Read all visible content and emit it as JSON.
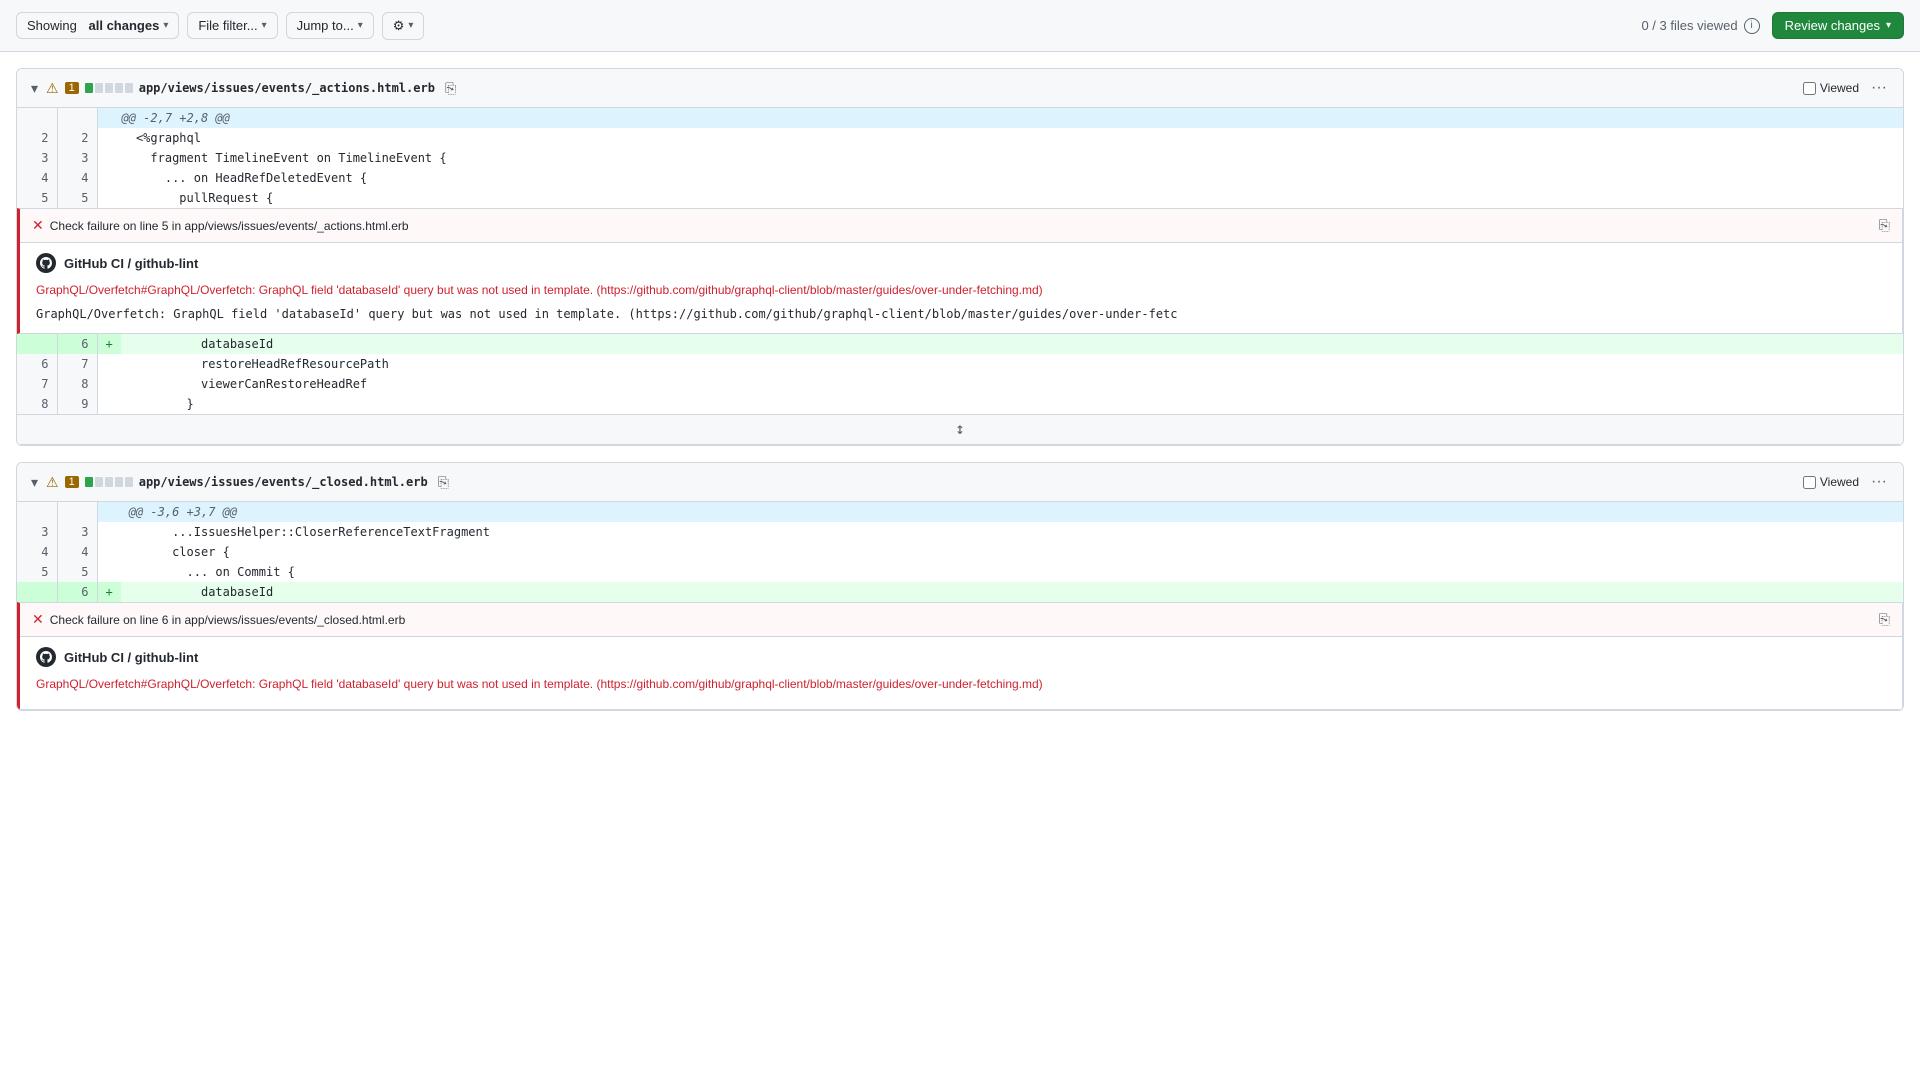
{
  "toolbar": {
    "showing_label": "Showing",
    "all_changes_label": "all changes",
    "file_filter_label": "File filter...",
    "jump_to_label": "Jump to...",
    "settings_label": "⚙",
    "files_viewed_label": "0 / 3 files viewed",
    "review_changes_label": "Review changes"
  },
  "file1": {
    "path": "app/views/issues/events/_actions.html.erb",
    "count": "1",
    "viewed_label": "Viewed",
    "hunk_header": "@@ -2,7 +2,8 @@",
    "check_failure_text": "Check failure on line 5 in app/views/issues/events/_actions.html.erb",
    "ci_name": "GitHub CI / github-lint",
    "error_red": "GraphQL/Overfetch#GraphQL/Overfetch: GraphQL field 'databaseId' query but was not used in template. (https://github.com/github/graphql-client/blob/master/guides/over-under-fetching.md)",
    "error_plain": "GraphQL/Overfetch: GraphQL field 'databaseId' query but was not used in template. (https://github.com/github/graphql-client/blob/master/guides/over-under-fetc",
    "lines": [
      {
        "old_num": "2",
        "new_num": "2",
        "type": "normal",
        "sign": " ",
        "code": "  <%graphql"
      },
      {
        "old_num": "3",
        "new_num": "3",
        "type": "normal",
        "sign": " ",
        "code": "    fragment TimelineEvent on TimelineEvent {"
      },
      {
        "old_num": "4",
        "new_num": "4",
        "type": "normal",
        "sign": " ",
        "code": "      ... on HeadRefDeletedEvent {"
      },
      {
        "old_num": "5",
        "new_num": "5",
        "type": "normal",
        "sign": " ",
        "code": "        pullRequest {"
      }
    ],
    "lines_after": [
      {
        "old_num": "6",
        "new_num": "7",
        "type": "normal",
        "sign": " ",
        "code": "          restoreHeadRefResourcePath"
      },
      {
        "old_num": "7",
        "new_num": "8",
        "type": "normal",
        "sign": " ",
        "code": "          viewerCanRestoreHeadRef"
      },
      {
        "old_num": "8",
        "new_num": "9",
        "type": "normal",
        "sign": " ",
        "code": "        }"
      }
    ],
    "line_add": {
      "old_num": "",
      "new_num": "6",
      "type": "add",
      "sign": "+",
      "code": "          databaseId"
    }
  },
  "file2": {
    "path": "app/views/issues/events/_closed.html.erb",
    "count": "1",
    "viewed_label": "Viewed",
    "hunk_header": "@@ -3,6 +3,7 @@",
    "check_failure_text": "Check failure on line 6 in app/views/issues/events/_closed.html.erb",
    "ci_name": "GitHub CI / github-lint",
    "error_red": "GraphQL/Overfetch#GraphQL/Overfetch: GraphQL field 'databaseId' query but was not used in template. (https://github.com/github/graphql-client/blob/master/guides/over-under-fetching.md)",
    "lines": [
      {
        "old_num": "3",
        "new_num": "3",
        "type": "normal",
        "sign": " ",
        "code": "      ...IssuesHelper::CloserReferenceTextFragment"
      },
      {
        "old_num": "4",
        "new_num": "4",
        "type": "normal",
        "sign": " ",
        "code": "      closer {"
      },
      {
        "old_num": "5",
        "new_num": "5",
        "type": "normal",
        "sign": " ",
        "code": "        ... on Commit {"
      }
    ],
    "line_add": {
      "old_num": "",
      "new_num": "6",
      "type": "add",
      "sign": "+",
      "code": "          databaseId"
    }
  },
  "colors": {
    "add_bg": "#e6ffec",
    "add_num_bg": "#ccffd8",
    "red": "#cf222e",
    "green": "#1a7f37"
  }
}
